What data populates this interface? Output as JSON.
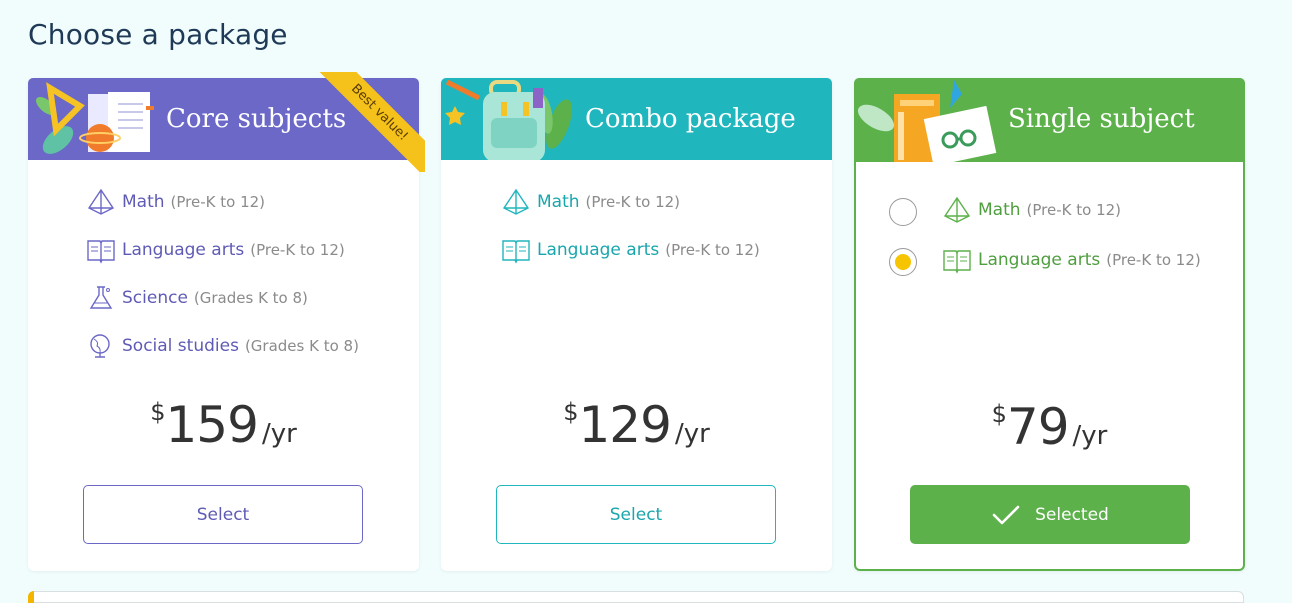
{
  "page": {
    "title": "Choose a package"
  },
  "colors": {
    "core": "#6c68c7",
    "combo": "#20b6bd",
    "single": "#5db14b",
    "badge": "#f4c21a",
    "radio_checked": "#f6c400"
  },
  "packages": [
    {
      "title": "Core subjects",
      "badge": "Best value!",
      "subjects": [
        {
          "name": "Math",
          "range": "(Pre-K to 12)",
          "icon": "pyramid-icon"
        },
        {
          "name": "Language arts",
          "range": "(Pre-K to 12)",
          "icon": "book-icon"
        },
        {
          "name": "Science",
          "range": "(Grades K to 8)",
          "icon": "flask-icon"
        },
        {
          "name": "Social studies",
          "range": "(Grades K to 8)",
          "icon": "globe-icon"
        }
      ],
      "price": {
        "currency": "$",
        "amount": "159",
        "period": "/yr"
      },
      "button": "Select"
    },
    {
      "title": "Combo package",
      "subjects": [
        {
          "name": "Math",
          "range": "(Pre-K to 12)",
          "icon": "pyramid-icon"
        },
        {
          "name": "Language arts",
          "range": "(Pre-K to 12)",
          "icon": "book-icon"
        }
      ],
      "price": {
        "currency": "$",
        "amount": "129",
        "period": "/yr"
      },
      "button": "Select"
    },
    {
      "title": "Single subject",
      "subjects": [
        {
          "name": "Math",
          "range": "(Pre-K to 12)",
          "icon": "pyramid-icon",
          "checked": false
        },
        {
          "name": "Language arts",
          "range": "(Pre-K to 12)",
          "icon": "book-icon",
          "checked": true
        }
      ],
      "price": {
        "currency": "$",
        "amount": "79",
        "period": "/yr"
      },
      "button": "Selected",
      "button_icon": "checkmark-icon",
      "selected": true
    }
  ]
}
